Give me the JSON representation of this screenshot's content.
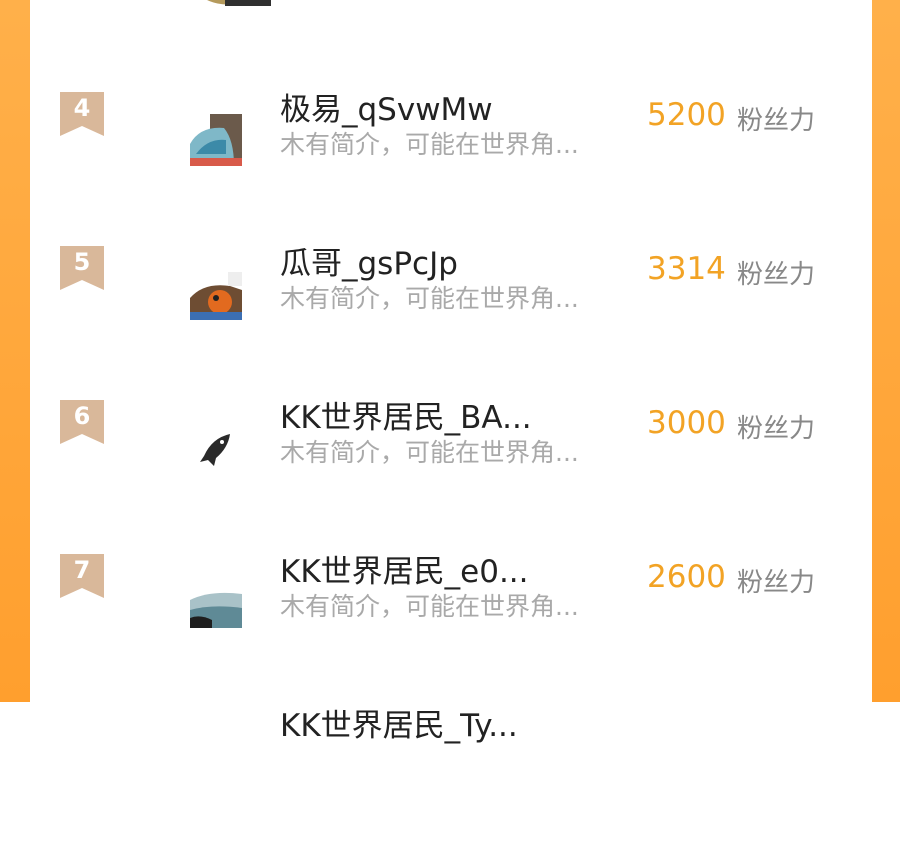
{
  "colors": {
    "background_orange": "#ffa53a",
    "card": "#ffffff",
    "rank_badge": "#d9b89a",
    "score": "#f2a325",
    "name": "#222222",
    "desc": "#a9a9a9",
    "label": "#888888"
  },
  "ranking": {
    "items": [
      {
        "rank": "4",
        "name": "极易_qSvwMw",
        "desc": "木有简介，可能在世界角...",
        "score": "5200",
        "score_label": "粉丝力"
      },
      {
        "rank": "5",
        "name": "瓜哥_gsPcJp",
        "desc": "木有简介，可能在世界角...",
        "score": "3314",
        "score_label": "粉丝力"
      },
      {
        "rank": "6",
        "name": "KK世界居民_BA...",
        "desc": "木有简介，可能在世界角...",
        "score": "3000",
        "score_label": "粉丝力"
      },
      {
        "rank": "7",
        "name": "KK世界居民_e0...",
        "desc": "木有简介，可能在世界角...",
        "score": "2600",
        "score_label": "粉丝力"
      },
      {
        "name": "KK世界居民_Ty..."
      }
    ]
  }
}
